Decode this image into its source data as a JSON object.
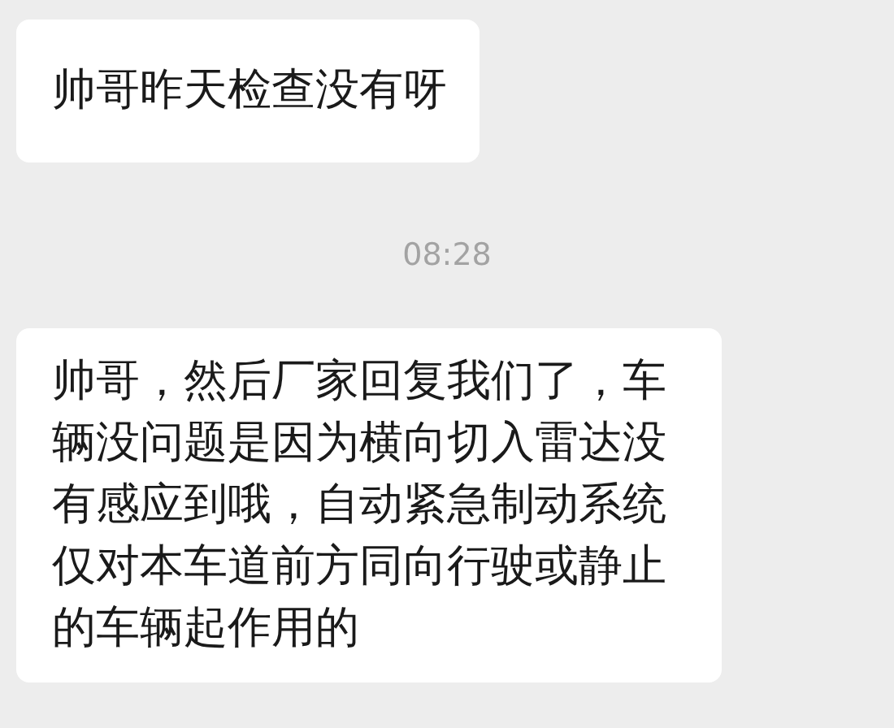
{
  "messages": [
    {
      "kind": "bubble",
      "text": "帅哥昨天检查没有呀"
    },
    {
      "kind": "time",
      "text": "08:28"
    },
    {
      "kind": "bubble",
      "text": "帅哥，然后厂家回复我们了，车辆没问题是因为横向切入雷达没有感应到哦，自动紧急制动系统仅对本车道前方同向行驶或静止的车辆起作用的"
    }
  ]
}
